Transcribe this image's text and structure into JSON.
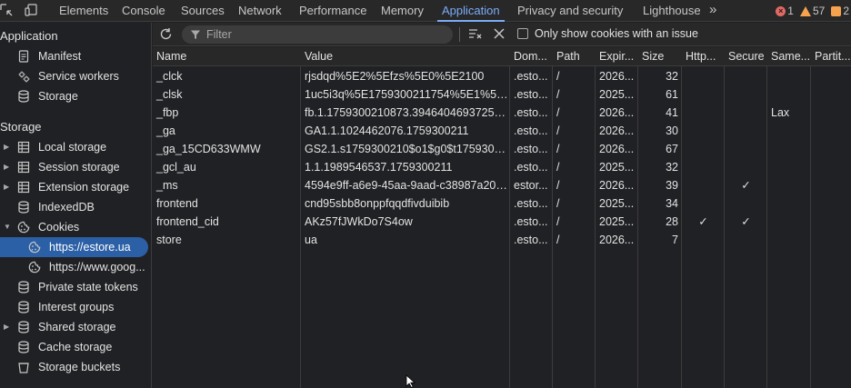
{
  "tabs": [
    {
      "label": "Elements",
      "active": false
    },
    {
      "label": "Console",
      "active": false
    },
    {
      "label": "Sources",
      "active": false
    },
    {
      "label": "Network",
      "active": false
    },
    {
      "label": "Performance",
      "active": false
    },
    {
      "label": "Memory",
      "active": false
    },
    {
      "label": "Application",
      "active": true
    },
    {
      "label": "Privacy and security",
      "active": false
    },
    {
      "label": "Lighthouse",
      "active": false
    }
  ],
  "overflow_glyph": "»",
  "counters": {
    "errors": "1",
    "warnings": "57",
    "issues": "2"
  },
  "colors": {
    "accent": "#7cacf8",
    "selected_bg": "#2b5fa6",
    "error": "#e46962",
    "warning": "#f7a34d"
  },
  "sidebar": {
    "application_header": "Application",
    "storage_header": "Storage",
    "app_items": [
      {
        "label": "Manifest",
        "icon": "document-icon"
      },
      {
        "label": "Service workers",
        "icon": "gear-icon"
      },
      {
        "label": "Storage",
        "icon": "database-icon"
      }
    ],
    "storage_items": [
      {
        "label": "Local storage",
        "icon": "grid-icon",
        "arrow": "collapsed"
      },
      {
        "label": "Session storage",
        "icon": "grid-icon",
        "arrow": "collapsed"
      },
      {
        "label": "Extension storage",
        "icon": "grid-icon",
        "arrow": "collapsed"
      },
      {
        "label": "IndexedDB",
        "icon": "database-icon",
        "arrow": "none"
      },
      {
        "label": "Cookies",
        "icon": "cookie-icon",
        "arrow": "expanded"
      },
      {
        "label": "https://estore.ua",
        "icon": "cookie-icon",
        "sub": true,
        "selected": true
      },
      {
        "label": "https://www.goog...",
        "icon": "cookie-icon",
        "sub": true
      },
      {
        "label": "Private state tokens",
        "icon": "database-icon",
        "arrow": "none"
      },
      {
        "label": "Interest groups",
        "icon": "database-icon",
        "arrow": "none"
      },
      {
        "label": "Shared storage",
        "icon": "database-icon",
        "arrow": "collapsed"
      },
      {
        "label": "Cache storage",
        "icon": "database-icon",
        "arrow": "none"
      },
      {
        "label": "Storage buckets",
        "icon": "bucket-icon",
        "arrow": "none"
      }
    ]
  },
  "toolbar": {
    "filter_placeholder": "Filter",
    "only_issues_label": "Only show cookies with an issue"
  },
  "table": {
    "columns": [
      "Name",
      "Value",
      "Dom...",
      "Path",
      "Expir...",
      "Size",
      "Http...",
      "Secure",
      "Same...",
      "Partit..."
    ],
    "rows": [
      [
        "_clck",
        "rjsdqd%5E2%5Efzs%5E0%5E2100",
        ".esto...",
        "/",
        "2026...",
        "32",
        "",
        "",
        "",
        ""
      ],
      [
        "_clsk",
        "1uc5i3q%5E1759300211754%5E1%5E1...",
        ".esto...",
        "/",
        "2025...",
        "61",
        "",
        "",
        "",
        ""
      ],
      [
        "_fbp",
        "fb.1.1759300210873.394640469372535...",
        ".esto...",
        "/",
        "2026...",
        "41",
        "",
        "",
        "Lax",
        ""
      ],
      [
        "_ga",
        "GA1.1.1024462076.1759300211",
        ".esto...",
        "/",
        "2026...",
        "30",
        "",
        "",
        "",
        ""
      ],
      [
        "_ga_15CD633WMW",
        "GS2.1.s1759300210$o1$g0$t175930021...",
        ".esto...",
        "/",
        "2026...",
        "67",
        "",
        "",
        "",
        ""
      ],
      [
        "_gcl_au",
        "1.1.1989546537.1759300211",
        ".esto...",
        "/",
        "2025...",
        "32",
        "",
        "",
        "",
        ""
      ],
      [
        "_ms",
        "4594e9ff-a6e9-45aa-9aad-c38987a20afe",
        "estor...",
        "/",
        "2026...",
        "39",
        "",
        "✓",
        "",
        ""
      ],
      [
        "frontend",
        "cnd95sbb8onppfqqdfivduibib",
        ".esto...",
        "/",
        "2025...",
        "34",
        "",
        "",
        "",
        ""
      ],
      [
        "frontend_cid",
        "AKz57fJWkDo7S4ow",
        ".esto...",
        "/",
        "2025...",
        "28",
        "✓",
        "✓",
        "",
        ""
      ],
      [
        "store",
        "ua",
        ".esto...",
        "/",
        "2026...",
        "7",
        "",
        "",
        "",
        ""
      ]
    ]
  }
}
